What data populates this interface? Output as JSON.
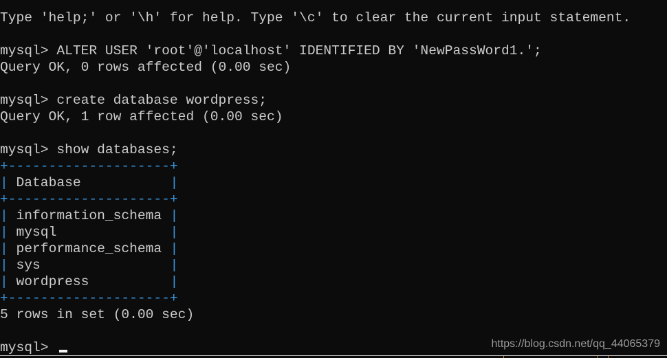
{
  "terminal": {
    "help_line": "Type 'help;' or '\\h' for help. Type '\\c' to clear the current input statement.",
    "prompt": "mysql> ",
    "commands": [
      {
        "input": "ALTER USER 'root'@'localhost' IDENTIFIED BY 'NewPassWord1.';",
        "output": "Query OK, 0 rows affected (0.00 sec)"
      },
      {
        "input": "create database wordpress;",
        "output": "Query OK, 1 row affected (0.00 sec)"
      },
      {
        "input": "show databases;",
        "output": "5 rows in set (0.00 sec)"
      }
    ],
    "table": {
      "border": "+--------------------+",
      "header": "Database",
      "rows": [
        "information_schema",
        "mysql",
        "performance_schema",
        "sys",
        "wordpress"
      ]
    }
  },
  "watermark": "https://blog.csdn.net/qq_44065379",
  "colors": {
    "background": "#0c0c0c",
    "text": "#cccccc",
    "table_border": "#3a96dd"
  }
}
